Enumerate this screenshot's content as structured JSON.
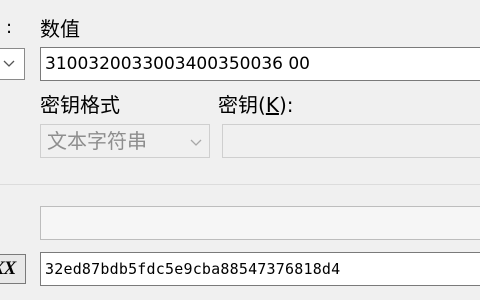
{
  "left_panel": {
    "colon": ":",
    "icon_glyph": "XX"
  },
  "labels": {
    "value": "数值",
    "key_format": "密钥格式",
    "key_prefix": "密钥(",
    "key_mnemonic": "K",
    "key_suffix": "):"
  },
  "value_input": {
    "value": "3100320033003400350036 00"
  },
  "key_format_select": {
    "selected": "文本字符串"
  },
  "key_input": {
    "value": ""
  },
  "output_blank": {
    "value": ""
  },
  "hash_output": {
    "value": "32ed87bdb5fdc5e9cba88547376818d4"
  }
}
